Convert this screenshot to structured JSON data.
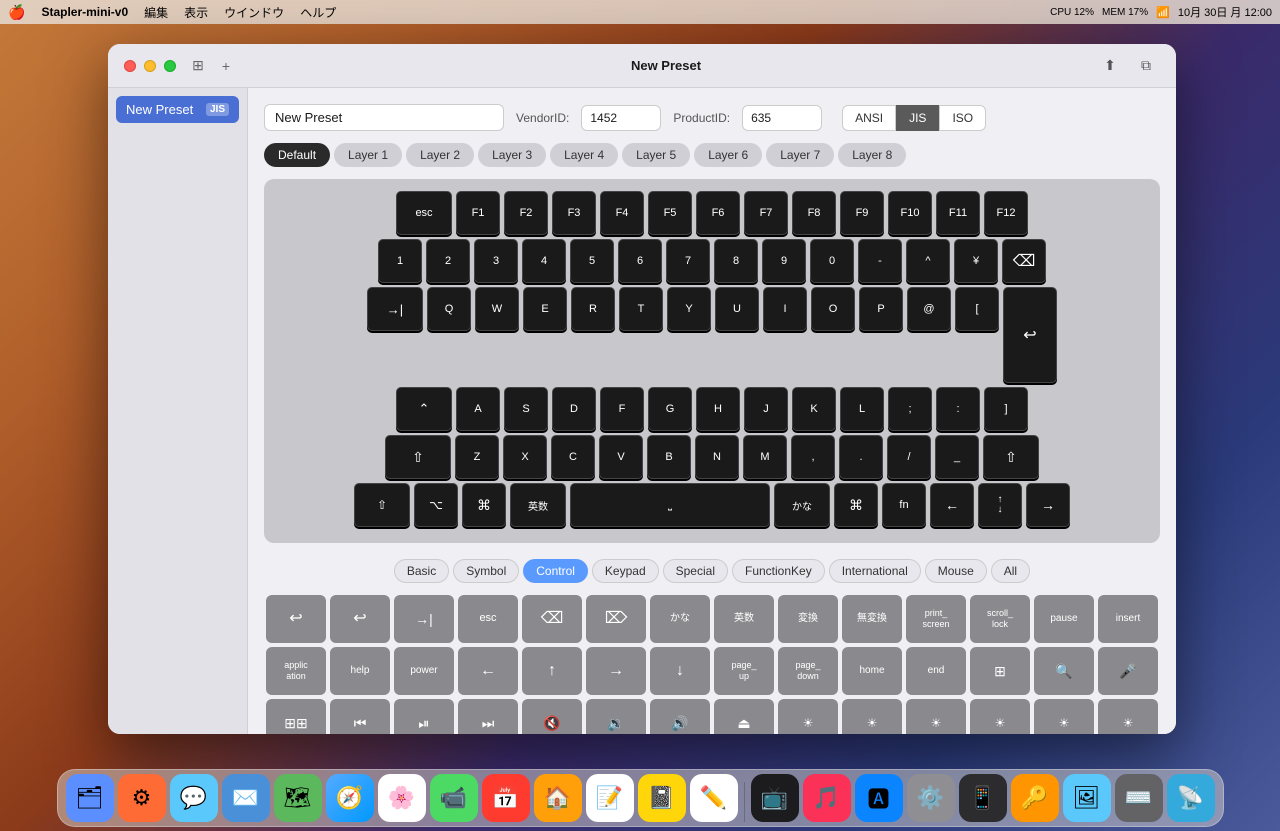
{
  "menubar": {
    "apple": "🍎",
    "app_name": "Stapler-mini-v0",
    "menus": [
      "編集",
      "表示",
      "ウインドウ",
      "ヘルプ"
    ],
    "cpu": "CPU 12%",
    "mem": "MEM 17%"
  },
  "window": {
    "title": "New Preset",
    "close_label": "×",
    "minimize_label": "−",
    "maximize_label": "+"
  },
  "sidebar": {
    "items": [
      {
        "label": "New Preset",
        "badge": "JIS",
        "active": true
      }
    ]
  },
  "topbar": {
    "preset_name": "New Preset",
    "preset_placeholder": "New Preset",
    "vendor_label": "VendorID:",
    "vendor_value": "1452",
    "product_label": "ProductID:",
    "product_value": "635",
    "layouts": [
      "ANSI",
      "JIS",
      "ISO"
    ],
    "active_layout": "JIS"
  },
  "layers": {
    "tabs": [
      "Default",
      "Layer 1",
      "Layer 2",
      "Layer 3",
      "Layer 4",
      "Layer 5",
      "Layer 6",
      "Layer 7",
      "Layer 8"
    ],
    "active": "Default"
  },
  "keyboard": {
    "row1": [
      "esc",
      "F1",
      "F2",
      "F3",
      "F4",
      "F5",
      "F6",
      "F7",
      "F8",
      "F9",
      "F10",
      "F11",
      "F12"
    ],
    "row2": [
      "1",
      "2",
      "3",
      "4",
      "5",
      "6",
      "7",
      "8",
      "9",
      "0",
      "-",
      "^",
      "¥",
      "⌫"
    ],
    "row3": [
      "→|",
      "Q",
      "W",
      "E",
      "R",
      "T",
      "Y",
      "U",
      "I",
      "O",
      "P",
      "@",
      "["
    ],
    "row4": [
      "A",
      "S",
      "D",
      "F",
      "G",
      "H",
      "J",
      "K",
      "L",
      ";",
      ":",
      "]"
    ],
    "row5": [
      "⇧",
      "Z",
      "X",
      "C",
      "V",
      "B",
      "N",
      "M",
      ",",
      ".",
      "/",
      "_",
      "⇧"
    ],
    "row6": [
      "⇧",
      "⌥",
      "⌘",
      "英数",
      "",
      "かな",
      "⌘",
      "fn",
      "←",
      "↑↓",
      "→"
    ]
  },
  "categories": {
    "tabs": [
      "Basic",
      "Symbol",
      "Control",
      "Keypad",
      "Special",
      "FunctionKey",
      "International",
      "Mouse",
      "All"
    ],
    "active": "Control"
  },
  "control_keys": [
    "↩",
    "↩",
    "→|",
    "esc",
    "⌫",
    "⌦",
    "かな",
    "英数",
    "変換",
    "無変換",
    "print_\nscreen",
    "scroll_\nlock",
    "pause",
    "insert",
    "applic\nation",
    "help",
    "power",
    "←",
    "↑",
    "→",
    "↓",
    "page_\nup",
    "page_\ndown",
    "home",
    "end",
    "⊞",
    "🔍",
    "🎤",
    "⊞⊞",
    "⏮",
    "⏯",
    "⏭",
    "🔇",
    "🔉",
    "🔊",
    "⏏",
    "☀-",
    "☀",
    "☀+",
    "☀++",
    "☀+++",
    "☀++++"
  ],
  "dock_icons": [
    {
      "name": "finder",
      "bg": "#5b8fff",
      "symbol": "🟦"
    },
    {
      "name": "launchpad",
      "bg": "#ff6b35",
      "symbol": "🟧"
    },
    {
      "name": "messages",
      "bg": "#5ac8fa",
      "symbol": "💬"
    },
    {
      "name": "mail",
      "bg": "#4a90d9",
      "symbol": "✉️"
    },
    {
      "name": "maps",
      "bg": "#5cb85c",
      "symbol": "🗺"
    },
    {
      "name": "safari",
      "bg": "#5ac8fa",
      "symbol": "🧭"
    },
    {
      "name": "photos",
      "bg": "#ff9500",
      "symbol": "🌸"
    },
    {
      "name": "facetime",
      "bg": "#4cd964",
      "symbol": "📹"
    },
    {
      "name": "calendar",
      "bg": "#ff3b30",
      "symbol": "📅"
    },
    {
      "name": "home",
      "bg": "#ff9f0a",
      "symbol": "🏠"
    },
    {
      "name": "reminders",
      "bg": "#ff3b30",
      "symbol": "📝"
    },
    {
      "name": "notes",
      "bg": "#ffd60a",
      "symbol": "📓"
    },
    {
      "name": "freeform",
      "bg": "#5856d6",
      "symbol": "✏️"
    },
    {
      "name": "appletv",
      "bg": "#1c1c1e",
      "symbol": "📺"
    },
    {
      "name": "music",
      "bg": "#fc3158",
      "symbol": "🎵"
    },
    {
      "name": "appstore",
      "bg": "#0a84ff",
      "symbol": "🅰"
    },
    {
      "name": "systemprefs",
      "bg": "#8e8e93",
      "symbol": "⚙️"
    },
    {
      "name": "iphone",
      "bg": "#2c2c2e",
      "symbol": "📱"
    },
    {
      "name": "keychainaccess",
      "bg": "#ff9500",
      "symbol": "🔑"
    },
    {
      "name": "preview",
      "bg": "#5ac8fa",
      "symbol": "🖼"
    },
    {
      "name": "keyboard",
      "bg": "#636366",
      "symbol": "⌨️"
    },
    {
      "name": "airdrop",
      "bg": "#5ac8fa",
      "symbol": "📡"
    }
  ]
}
